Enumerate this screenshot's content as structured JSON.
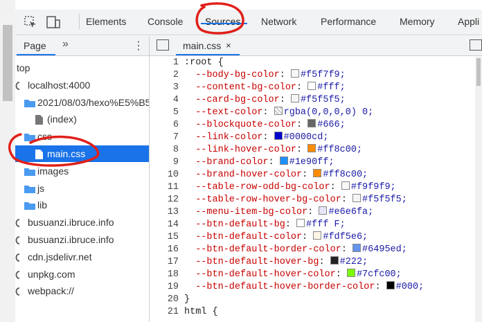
{
  "devtools": {
    "tabs": [
      {
        "label": "Elements"
      },
      {
        "label": "Console"
      },
      {
        "label": "Sources"
      },
      {
        "label": "Network"
      },
      {
        "label": "Performance"
      },
      {
        "label": "Memory"
      },
      {
        "label": "Appli"
      }
    ],
    "active_tab": "Sources"
  },
  "navigator": {
    "tab_label": "Page",
    "more_label": "»",
    "menu_label": "⋮",
    "tree": [
      {
        "label": "top",
        "icon": "frame-icon"
      },
      {
        "label": "localhost:4000",
        "icon": "cloud-icon"
      },
      {
        "label": "2021/08/03/hexo%E5%B5",
        "icon": "folder-icon"
      },
      {
        "label": "(index)",
        "icon": "file-icon"
      },
      {
        "label": "css",
        "icon": "folder-icon"
      },
      {
        "label": "main.css",
        "icon": "file-icon",
        "selected": true
      },
      {
        "label": "images",
        "icon": "folder-icon"
      },
      {
        "label": "js",
        "icon": "folder-icon"
      },
      {
        "label": "lib",
        "icon": "folder-icon"
      },
      {
        "label": "busuanzi.ibruce.info",
        "icon": "cloud-icon"
      },
      {
        "label": "busuanzi.ibruce.info",
        "icon": "cloud-icon"
      },
      {
        "label": "cdn.jsdelivr.net",
        "icon": "cloud-icon"
      },
      {
        "label": "unpkg.com",
        "icon": "cloud-icon"
      },
      {
        "label": "webpack://",
        "icon": "cloud-icon"
      }
    ]
  },
  "editor": {
    "file_tab": "main.css",
    "close_label": "×",
    "lines": [
      {
        "n": "1",
        "prop": ":root",
        "sep": " {",
        "swatch": "",
        "val": ""
      },
      {
        "n": "2",
        "prop": "  --body-bg-color",
        "sep": ": ",
        "swatch": "#f5f7f9",
        "val": "#f5f7f9;"
      },
      {
        "n": "3",
        "prop": "  --content-bg-color",
        "sep": ": ",
        "swatch": "#ffffff",
        "val": "#fff;"
      },
      {
        "n": "4",
        "prop": "  --card-bg-color",
        "sep": ": ",
        "swatch": "#f5f5f5",
        "val": "#f5f5f5;"
      },
      {
        "n": "5",
        "prop": "  --text-color",
        "sep": ": ",
        "swatch": "transparent",
        "val": "rgba(0,0,0,0) 0;"
      },
      {
        "n": "6",
        "prop": "  --blockquote-color",
        "sep": ": ",
        "swatch": "#666666",
        "val": "#666;"
      },
      {
        "n": "7",
        "prop": "  --link-color",
        "sep": ": ",
        "swatch": "#0000cd",
        "val": "#0000cd;"
      },
      {
        "n": "8",
        "prop": "  --link-hover-color",
        "sep": ": ",
        "swatch": "#ff8c00",
        "val": "#ff8c00;"
      },
      {
        "n": "9",
        "prop": "  --brand-color",
        "sep": ": ",
        "swatch": "#1e90ff",
        "val": "#1e90ff;"
      },
      {
        "n": "10",
        "prop": "  --brand-hover-color",
        "sep": ": ",
        "swatch": "#ff8c00",
        "val": "#ff8c00;"
      },
      {
        "n": "11",
        "prop": "  --table-row-odd-bg-color",
        "sep": ": ",
        "swatch": "#f9f9f9",
        "val": "#f9f9f9;"
      },
      {
        "n": "12",
        "prop": "  --table-row-hover-bg-color",
        "sep": ": ",
        "swatch": "#f5f5f5",
        "val": "#f5f5f5;"
      },
      {
        "n": "13",
        "prop": "  --menu-item-bg-color",
        "sep": ": ",
        "swatch": "#e6e6fa",
        "val": "#e6e6fa;"
      },
      {
        "n": "14",
        "prop": "  --btn-default-bg",
        "sep": ": ",
        "swatch": "#ffffff",
        "val": "#fff F;"
      },
      {
        "n": "15",
        "prop": "  --btn-default-color",
        "sep": ": ",
        "swatch": "#fdf5e6",
        "val": "#fdf5e6;"
      },
      {
        "n": "16",
        "prop": "  --btn-default-border-color",
        "sep": ": ",
        "swatch": "#6495ed",
        "val": "#6495ed;"
      },
      {
        "n": "17",
        "prop": "  --btn-default-hover-bg",
        "sep": ": ",
        "swatch": "#222222",
        "val": "#222;"
      },
      {
        "n": "18",
        "prop": "  --btn-default-hover-color",
        "sep": ": ",
        "swatch": "#7cfc00",
        "val": "#7cfc00;"
      },
      {
        "n": "19",
        "prop": "  --btn-default-hover-border-color",
        "sep": ": ",
        "swatch": "#000000",
        "val": "#000;"
      },
      {
        "n": "20",
        "prop": "}",
        "sep": "",
        "swatch": "",
        "val": ""
      },
      {
        "n": "21",
        "prop": "html",
        "sep": " {",
        "swatch": "",
        "val": ""
      }
    ]
  },
  "colors": {
    "accent": "#1a73e8",
    "annotation": "#e0201a",
    "panel_bg": "#f1f3f4"
  }
}
